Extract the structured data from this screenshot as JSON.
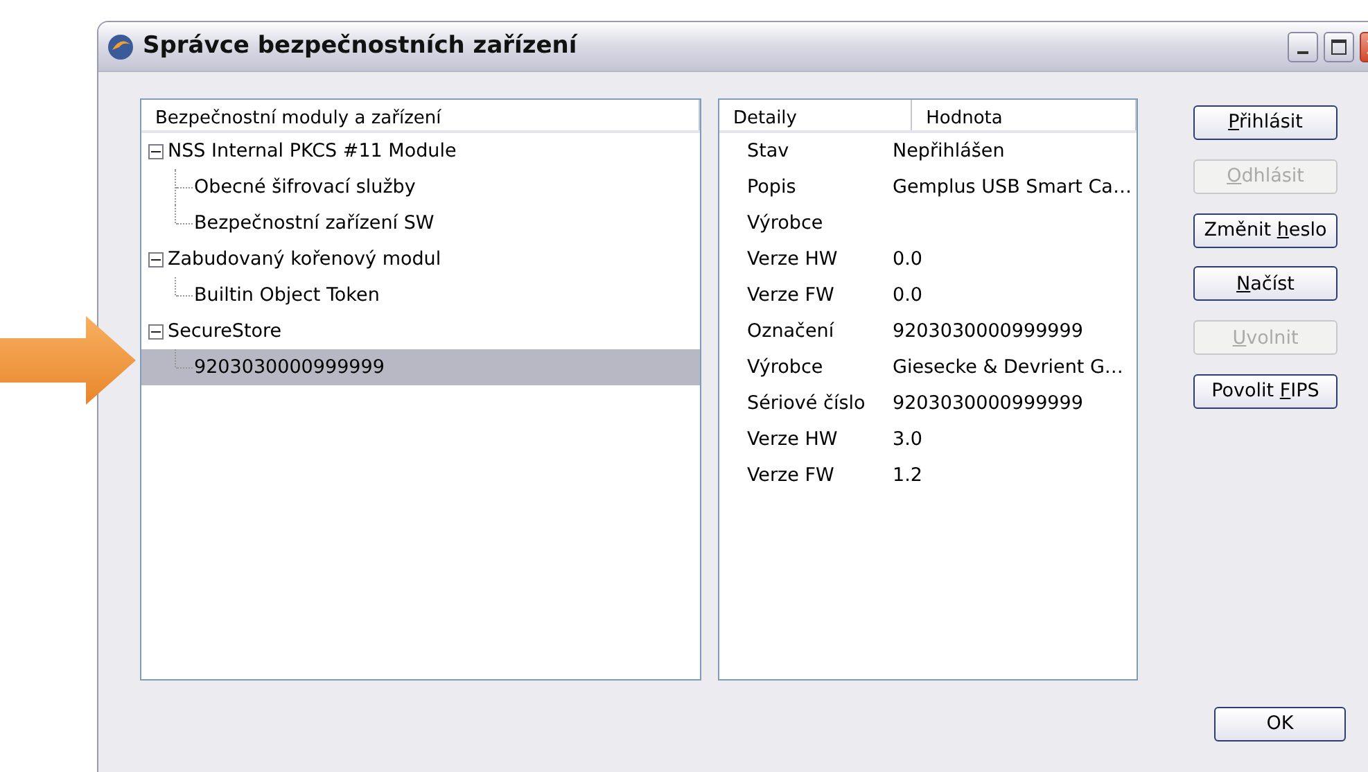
{
  "window": {
    "title": "Správce bezpečnostních zařízení"
  },
  "tree": {
    "header": "Bezpečnostní moduly a zařízení",
    "items": [
      {
        "label": "NSS Internal PKCS #11 Module",
        "expanded": true,
        "selected": false,
        "children": [
          {
            "label": "Obecné šifrovací služby",
            "selected": false
          },
          {
            "label": "Bezpečnostní zařízení SW",
            "selected": false
          }
        ]
      },
      {
        "label": "Zabudovaný kořenový modul",
        "expanded": true,
        "selected": false,
        "children": [
          {
            "label": "Builtin Object Token",
            "selected": false
          }
        ]
      },
      {
        "label": "SecureStore",
        "expanded": true,
        "selected": false,
        "children": [
          {
            "label": "9203030000999999",
            "selected": true
          }
        ]
      }
    ]
  },
  "details": {
    "columns": [
      "Detaily",
      "Hodnota"
    ],
    "rows": [
      [
        "Stav",
        "Nepřihlášen"
      ],
      [
        "Popis",
        "Gemplus USB Smart Ca…"
      ],
      [
        "Výrobce"
      ],
      [
        "Verze HW",
        "0.0"
      ],
      [
        "Verze FW",
        "0.0"
      ],
      [
        "Označení",
        "9203030000999999"
      ],
      [
        "Výrobce",
        "Giesecke & Devrient G…"
      ],
      [
        "Sériové číslo",
        "9203030000999999"
      ],
      [
        "Verze HW",
        "3.0"
      ],
      [
        "Verze FW",
        "1.2"
      ]
    ]
  },
  "buttons": [
    {
      "key": "P",
      "post": "řihlásit",
      "disabled": false
    },
    {
      "key": "O",
      "post": "dhlásit",
      "disabled": true
    },
    {
      "pre": "Změnit ",
      "key": "h",
      "post": "eslo",
      "disabled": false
    },
    {
      "key": "N",
      "post": "ačíst",
      "disabled": false
    },
    {
      "key": "U",
      "post": "volnit",
      "disabled": true
    },
    {
      "pre": "Povolit ",
      "key": "F",
      "post": "IPS",
      "disabled": false
    }
  ],
  "ok_button": {
    "label": "OK"
  }
}
